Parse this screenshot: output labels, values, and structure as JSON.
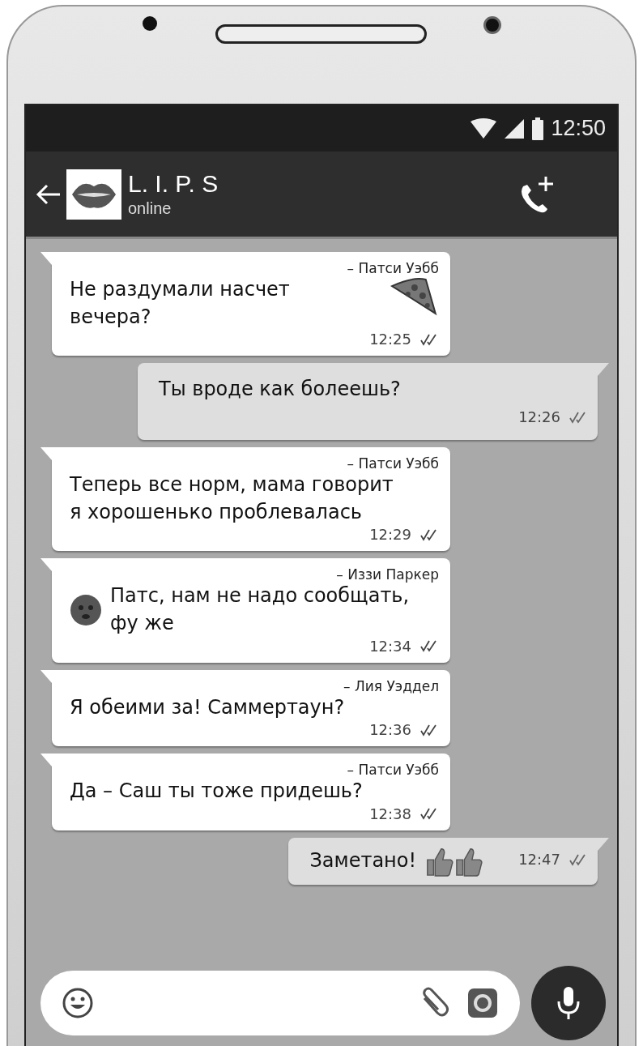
{
  "status_bar": {
    "time": "12:50"
  },
  "header": {
    "title": "L. I. P. S",
    "status": "online"
  },
  "messages": [
    {
      "kind": "incoming",
      "sender": "– Патси Уэбб",
      "text": "Не раздумали насчет вечера?",
      "emoji": {
        "kind": "pizza"
      },
      "time": "12:25"
    },
    {
      "kind": "outgoing",
      "text": "Ты вроде как болеешь?",
      "time": "12:26"
    },
    {
      "kind": "incoming",
      "sender": "– Патси Уэбб",
      "text": "Теперь все норм, мама говорит я хорошенько проблевалась",
      "time": "12:29"
    },
    {
      "kind": "incoming",
      "sender": "– Иззи Паркер",
      "text": "Патс, нам не надо сообщать, фу же",
      "emoji": {
        "kind": "face"
      },
      "time": "12:34"
    },
    {
      "kind": "incoming",
      "sender": "– Лия Уэддел",
      "text": "Я обеими за! Саммертаун?",
      "time": "12:36"
    },
    {
      "kind": "incoming",
      "sender": "– Патси Уэбб",
      "text": "Да – Саш ты тоже придешь?",
      "time": "12:38"
    },
    {
      "kind": "outgoing",
      "text": "Заметано!",
      "emoji": {
        "kind": "thumbs"
      },
      "time": "12:47"
    }
  ]
}
